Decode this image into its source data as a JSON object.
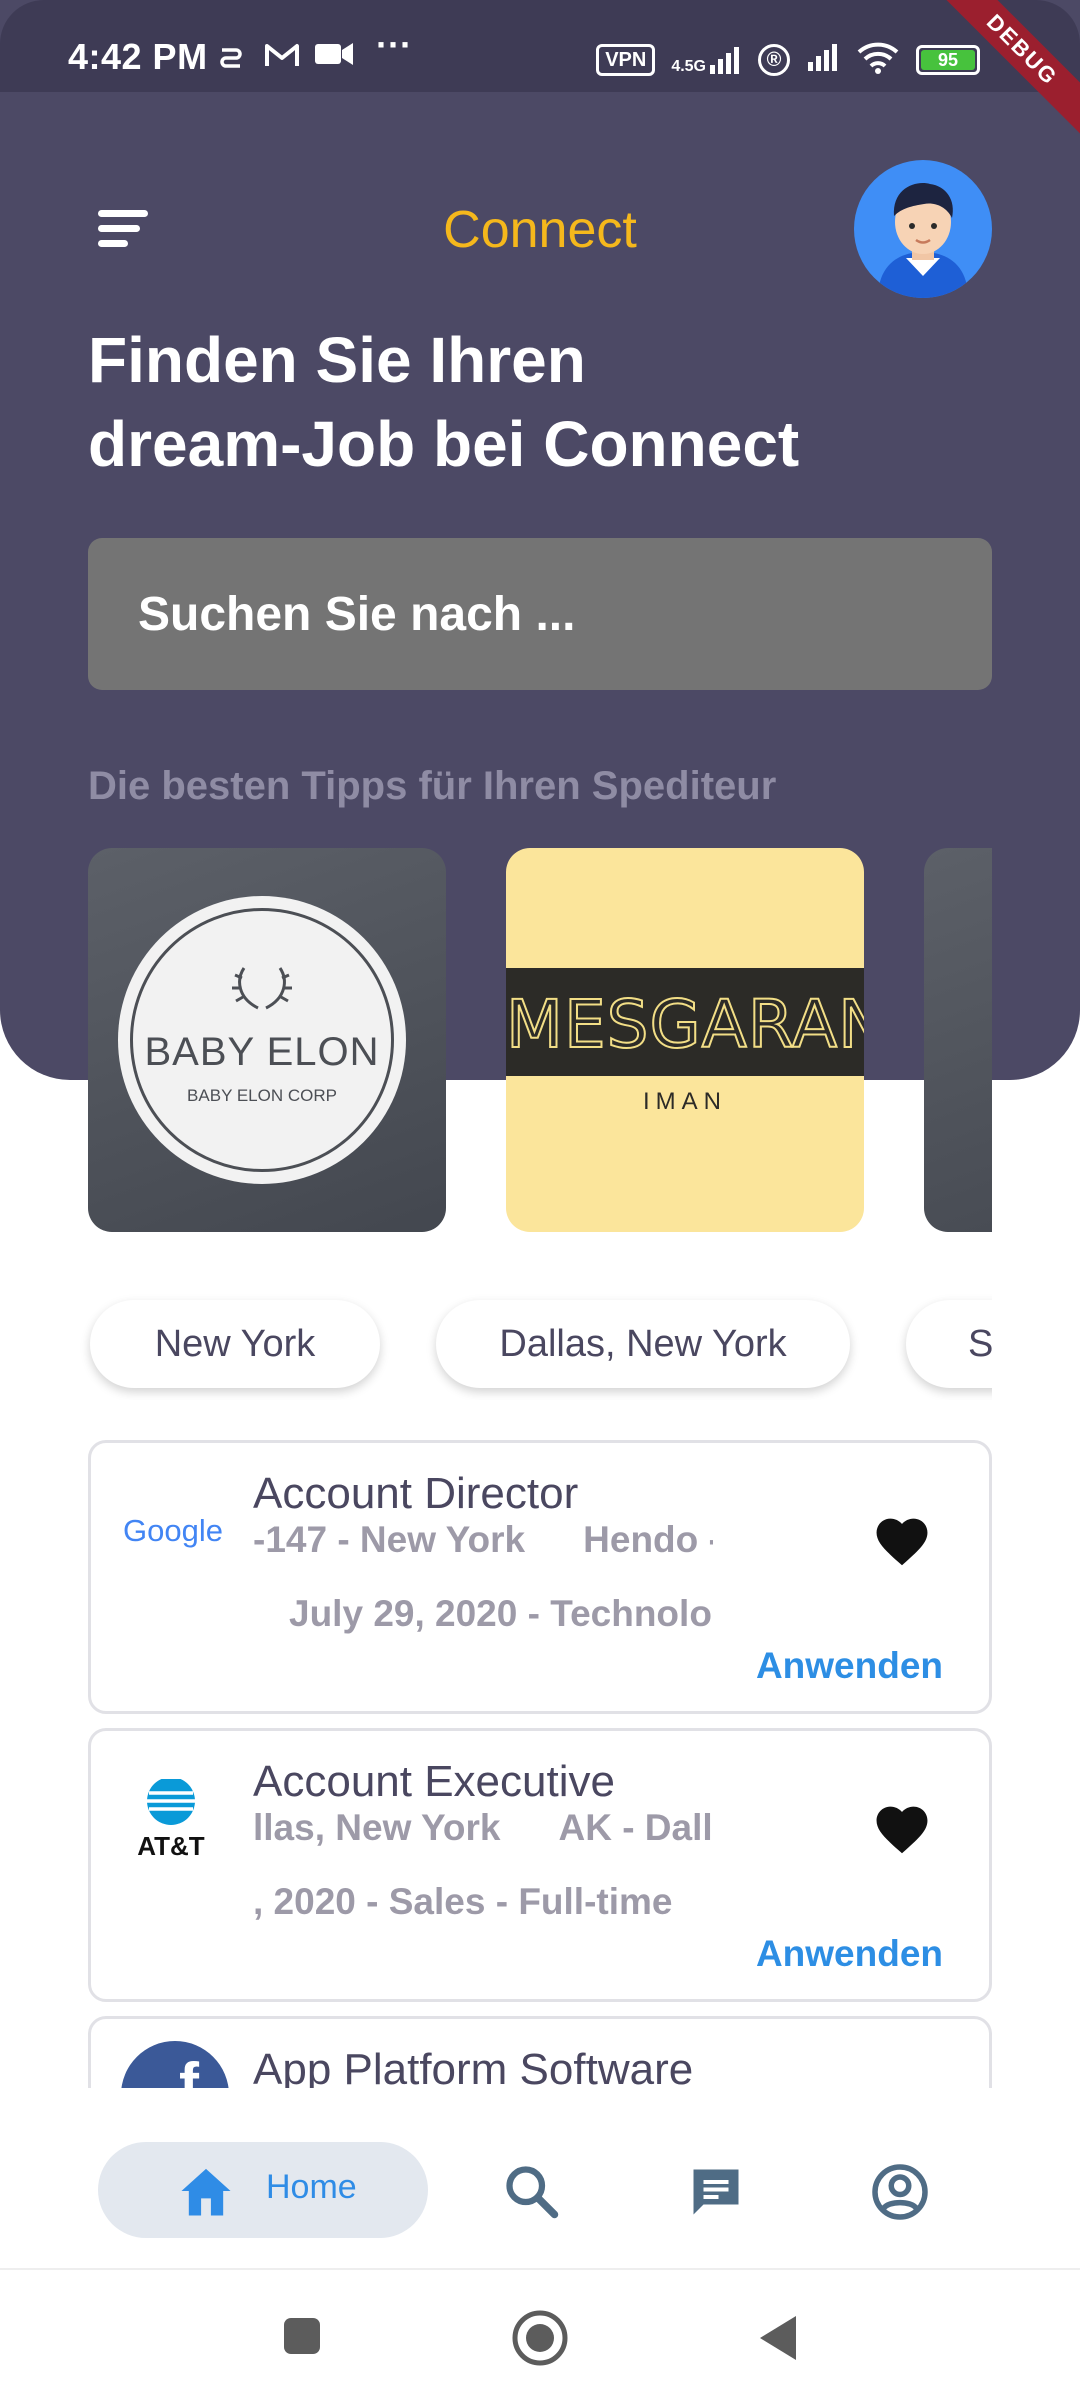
{
  "status_bar": {
    "time": "4:42 PM",
    "dots": "···",
    "vpn": "VPN",
    "network": "4.5G",
    "registered": "®",
    "battery": "95",
    "debug": "DEBUG"
  },
  "header": {
    "app_title": "Connect",
    "heading_line1": "Finden Sie Ihren",
    "heading_line2": "dream-Job bei Connect"
  },
  "search": {
    "placeholder": "Suchen Sie nach ..."
  },
  "tips": {
    "title": "Die besten Tipps für Ihren Spediteur"
  },
  "companies": [
    {
      "name": "BABY ELON",
      "subtitle": "BABY ELON CORP"
    },
    {
      "name": "MESGARAN",
      "subtitle": "IMAN"
    }
  ],
  "locations": [
    "New York",
    "Dallas, New York",
    "S"
  ],
  "jobs": [
    {
      "company_logo": "Google",
      "title": "Account Director",
      "line1a": "-147 - New York",
      "line1b": "Hendo -",
      "line2": "July 29, 2020 - Technolo",
      "apply": "Anwenden"
    },
    {
      "company_logo": "AT&T",
      "title": "Account Executive",
      "line1a": "llas, New York",
      "line1b": "AK - Dalla",
      "line2": ", 2020 - Sales - Full-time",
      "apply": "Anwenden"
    },
    {
      "company_logo": "f",
      "title": "App Platform Software"
    }
  ],
  "bottom_nav": {
    "home_label": "Home",
    "items": [
      "home-icon",
      "search-icon",
      "chat-icon",
      "account-icon"
    ]
  },
  "colors": {
    "hero_bg": "#4c4965",
    "accent": "#f5b81c",
    "apply": "#2d8ee4"
  }
}
